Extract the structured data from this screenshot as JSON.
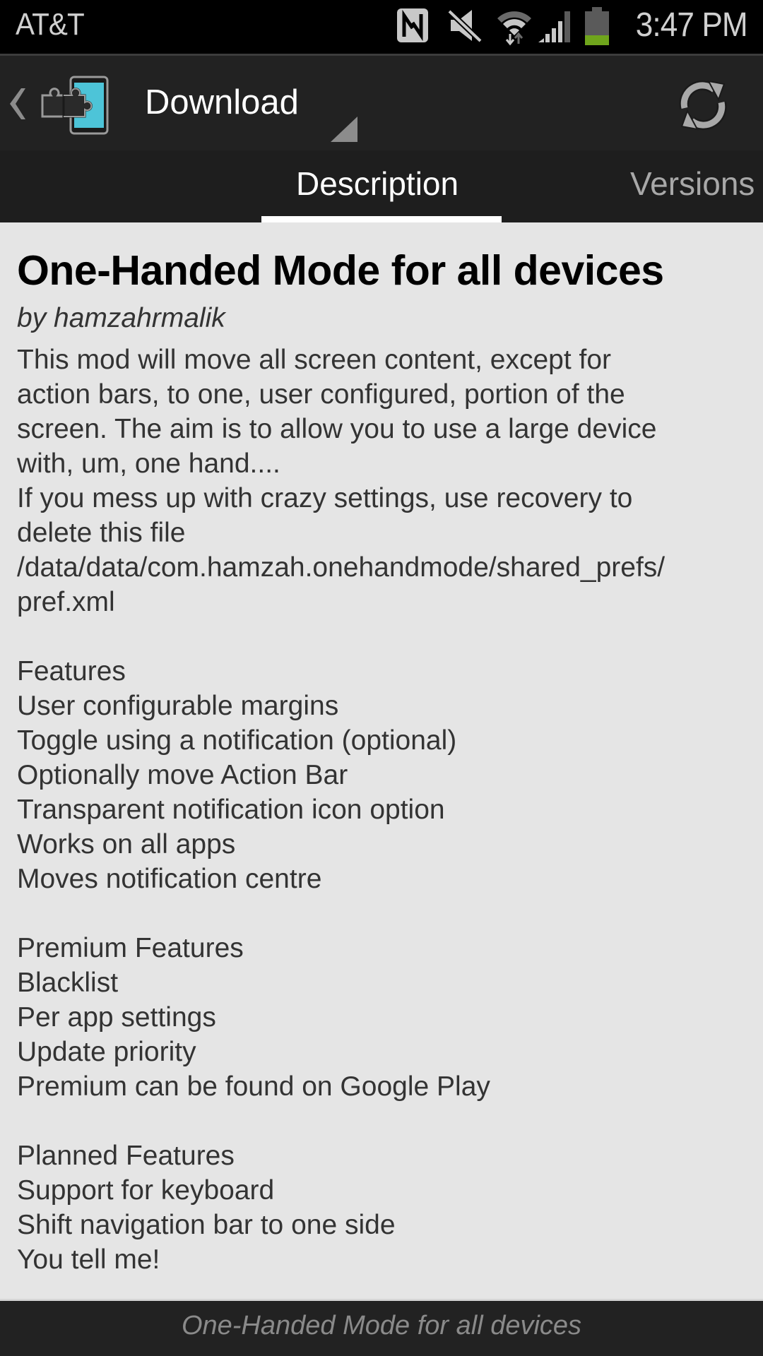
{
  "status_bar": {
    "carrier": "AT&T",
    "time": "3:47 PM",
    "icons": [
      "nfc-icon",
      "mute-icon",
      "wifi-icon",
      "signal-icon",
      "battery-icon"
    ],
    "battery_level_fraction": 0.3,
    "battery_color": "#6fa51c"
  },
  "action_bar": {
    "back_icon": "chevron-left-icon",
    "app_icon": "xposed-installer-icon",
    "title": "Download",
    "refresh_icon": "refresh-icon"
  },
  "tabs": [
    {
      "label": "Description",
      "selected": true
    },
    {
      "label": "Versions",
      "selected": false
    }
  ],
  "module": {
    "title": "One-Handed Mode for all devices",
    "author": "by hamzahrmalik",
    "description_lines": [
      "This mod will move all screen content, except for",
      "action bars, to one, user configured, portion of the",
      "screen. The aim is to allow you to use a large device",
      "with, um, one hand....",
      "If you mess up with crazy settings, use recovery to",
      "delete this file",
      "/data/data/com.hamzah.onehandmode/shared_prefs/",
      "pref.xml",
      "",
      "Features",
      "User configurable margins",
      "Toggle using a notification (optional)",
      "Optionally move Action Bar",
      "Transparent notification icon option",
      "Works on all apps",
      "Moves notification centre",
      "",
      "Premium Features",
      "Blacklist",
      "Per app settings",
      "Update priority",
      "Premium can be found on Google Play",
      "",
      "Planned Features",
      "Support for keyboard",
      "Shift navigation bar to one side",
      "You tell me!"
    ]
  },
  "footer": {
    "text": "One-Handed Mode for all devices"
  },
  "colors": {
    "accent_icon": "#4dc4d8",
    "action_bar_bg": "#222222",
    "content_bg": "#e5e5e5"
  }
}
